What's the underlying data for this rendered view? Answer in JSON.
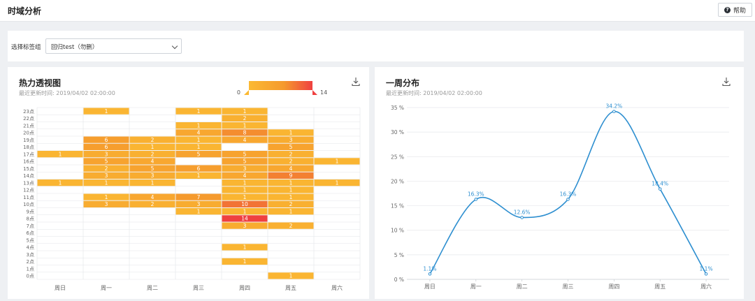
{
  "header": {
    "title": "时域分析",
    "help_label": "帮助"
  },
  "filter": {
    "label": "选择标签组",
    "selected": "回归test（勿删）"
  },
  "heatmap": {
    "title": "热力透视图",
    "updated_label": "最近更新时间:",
    "updated_time": "2019/04/02 02:00:00",
    "legend_min": "0",
    "legend_max": "14",
    "colors": {
      "low": "#fbb933",
      "mid": "#f59a2d",
      "high": "#ef4040"
    }
  },
  "weekly": {
    "title": "一周分布",
    "updated_label": "最近更新时间:",
    "updated_time": "2019/04/02 02:00:00",
    "line_color": "#2e8fd0"
  },
  "chart_data": [
    {
      "type": "heatmap",
      "title": "热力透视图",
      "x_categories": [
        "周日",
        "周一",
        "周二",
        "周三",
        "周四",
        "周五",
        "周六"
      ],
      "y_categories": [
        "0点",
        "1点",
        "2点",
        "3点",
        "4点",
        "5点",
        "6点",
        "7点",
        "8点",
        "9点",
        "10点",
        "11点",
        "12点",
        "13点",
        "14点",
        "15点",
        "16点",
        "17点",
        "18点",
        "19点",
        "20点",
        "21点",
        "22点",
        "23点"
      ],
      "value_range": [
        0,
        14
      ],
      "cells": [
        [
          1,
          23,
          1
        ],
        [
          3,
          23,
          1
        ],
        [
          4,
          23,
          1
        ],
        [
          4,
          22,
          2
        ],
        [
          3,
          21,
          1
        ],
        [
          4,
          21,
          1
        ],
        [
          3,
          20,
          4
        ],
        [
          4,
          20,
          8
        ],
        [
          5,
          20,
          1
        ],
        [
          1,
          19,
          6
        ],
        [
          2,
          19,
          2
        ],
        [
          3,
          19,
          1
        ],
        [
          4,
          19,
          4
        ],
        [
          5,
          19,
          3
        ],
        [
          1,
          18,
          6
        ],
        [
          2,
          18,
          1
        ],
        [
          3,
          18,
          1
        ],
        [
          5,
          18,
          5
        ],
        [
          0,
          17,
          1
        ],
        [
          1,
          17,
          3
        ],
        [
          2,
          17,
          2
        ],
        [
          3,
          17,
          5
        ],
        [
          4,
          17,
          5
        ],
        [
          5,
          17,
          2
        ],
        [
          1,
          16,
          5
        ],
        [
          2,
          16,
          4
        ],
        [
          4,
          16,
          5
        ],
        [
          5,
          16,
          2
        ],
        [
          6,
          16,
          1
        ],
        [
          1,
          15,
          2
        ],
        [
          2,
          15,
          5
        ],
        [
          3,
          15,
          6
        ],
        [
          4,
          15,
          3
        ],
        [
          5,
          15,
          4
        ],
        [
          1,
          14,
          3
        ],
        [
          2,
          14,
          3
        ],
        [
          3,
          14,
          1
        ],
        [
          4,
          14,
          4
        ],
        [
          5,
          14,
          9
        ],
        [
          0,
          13,
          1
        ],
        [
          1,
          13,
          1
        ],
        [
          2,
          13,
          1
        ],
        [
          4,
          13,
          1
        ],
        [
          5,
          13,
          1
        ],
        [
          6,
          13,
          1
        ],
        [
          4,
          12,
          1
        ],
        [
          5,
          12,
          1
        ],
        [
          1,
          11,
          1
        ],
        [
          2,
          11,
          4
        ],
        [
          3,
          11,
          7
        ],
        [
          4,
          11,
          1
        ],
        [
          5,
          11,
          1
        ],
        [
          1,
          10,
          3
        ],
        [
          2,
          10,
          2
        ],
        [
          3,
          10,
          3
        ],
        [
          4,
          10,
          10
        ],
        [
          5,
          10,
          2
        ],
        [
          3,
          9,
          1
        ],
        [
          4,
          9,
          1
        ],
        [
          5,
          9,
          1
        ],
        [
          4,
          8,
          14
        ],
        [
          4,
          7,
          3
        ],
        [
          5,
          7,
          2
        ],
        [
          4,
          4,
          1
        ],
        [
          4,
          2,
          1
        ],
        [
          5,
          0,
          1
        ]
      ]
    },
    {
      "type": "line",
      "title": "一周分布",
      "categories": [
        "周日",
        "周一",
        "周二",
        "周三",
        "周四",
        "周五",
        "周六"
      ],
      "values": [
        1.1,
        16.3,
        12.6,
        16.3,
        34.2,
        18.4,
        1.1
      ],
      "value_labels": [
        "1.1%",
        "16.3%",
        "12.6%",
        "16.3%",
        "34.2%",
        "18.4%",
        "1.1%"
      ],
      "y_ticks": [
        0,
        5,
        10,
        15,
        20,
        25,
        30,
        35
      ],
      "y_tick_labels": [
        "0 %",
        "5 %",
        "10 %",
        "15 %",
        "20 %",
        "25 %",
        "30 %",
        "35 %"
      ],
      "ylim": [
        0,
        35
      ],
      "grid": true,
      "smooth": true
    }
  ]
}
